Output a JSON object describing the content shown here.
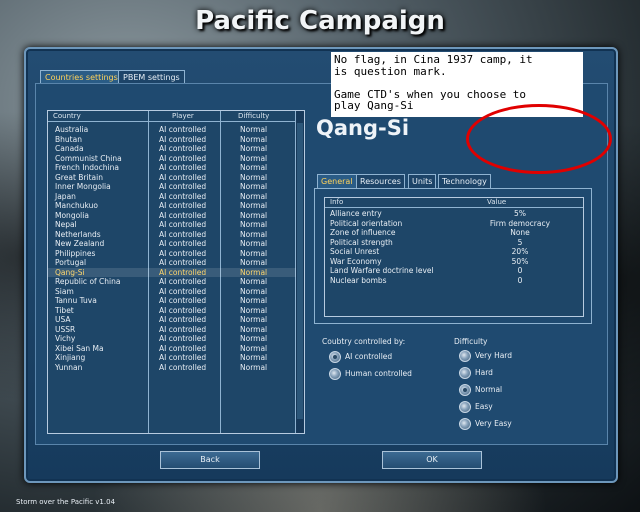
{
  "title": "Pacific Campaign",
  "tabs": [
    "Countries settings",
    "PBEM settings"
  ],
  "list": {
    "headers": [
      "Country",
      "Player",
      "Difficulty"
    ],
    "rows": [
      [
        "Australia",
        "AI controlled",
        "Normal"
      ],
      [
        "Bhutan",
        "AI controlled",
        "Normal"
      ],
      [
        "Canada",
        "AI controlled",
        "Normal"
      ],
      [
        "Communist China",
        "AI controlled",
        "Normal"
      ],
      [
        "French Indochina",
        "AI controlled",
        "Normal"
      ],
      [
        "Great Britain",
        "AI controlled",
        "Normal"
      ],
      [
        "Inner Mongolia",
        "AI controlled",
        "Normal"
      ],
      [
        "Japan",
        "AI controlled",
        "Normal"
      ],
      [
        "Manchukuo",
        "AI controlled",
        "Normal"
      ],
      [
        "Mongolia",
        "AI controlled",
        "Normal"
      ],
      [
        "Nepal",
        "AI controlled",
        "Normal"
      ],
      [
        "Netherlands",
        "AI controlled",
        "Normal"
      ],
      [
        "New Zealand",
        "AI controlled",
        "Normal"
      ],
      [
        "Philippines",
        "AI controlled",
        "Normal"
      ],
      [
        "Portugal",
        "AI controlled",
        "Normal"
      ],
      [
        "Qang-Si",
        "AI controlled",
        "Normal"
      ],
      [
        "Republic of China",
        "AI controlled",
        "Normal"
      ],
      [
        "Siam",
        "AI controlled",
        "Normal"
      ],
      [
        "Tannu Tuva",
        "AI controlled",
        "Normal"
      ],
      [
        "Tibet",
        "AI controlled",
        "Normal"
      ],
      [
        "USA",
        "AI controlled",
        "Normal"
      ],
      [
        "USSR",
        "AI controlled",
        "Normal"
      ],
      [
        "Vichy",
        "AI controlled",
        "Normal"
      ],
      [
        "Xibei San Ma",
        "AI controlled",
        "Normal"
      ],
      [
        "Xinjiang",
        "AI controlled",
        "Normal"
      ],
      [
        "Yunnan",
        "AI controlled",
        "Normal"
      ]
    ],
    "selected_index": 15
  },
  "country_name": "Qang-Si",
  "info_tabs": [
    "General",
    "Resources",
    "Units",
    "Technology"
  ],
  "info": {
    "headers": [
      "Info",
      "Value"
    ],
    "rows": [
      [
        "Alliance entry",
        "5%"
      ],
      [
        "Political orientation",
        "Firm democracy"
      ],
      [
        "Zone of influence",
        "None"
      ],
      [
        "Political strength",
        "5"
      ],
      [
        "Social Unrest",
        "20%"
      ],
      [
        "War Economy",
        "50%"
      ],
      [
        "Land Warfare doctrine level",
        "0"
      ],
      [
        "Nuclear bombs",
        "0"
      ]
    ]
  },
  "control": {
    "label": "Coubtry controlled by:",
    "options": [
      "AI controlled",
      "Human controlled"
    ],
    "selected": "AI controlled"
  },
  "difficulty": {
    "label": "Difficulty",
    "options": [
      "Very Hard",
      "Hard",
      "Normal",
      "Easy",
      "Very Easy"
    ],
    "selected": "Normal"
  },
  "buttons": {
    "back": "Back",
    "ok": "OK"
  },
  "version": "Storm over the Pacific v1.04",
  "annotation": {
    "text": "No flag, in Cina 1937 camp, it\nis question mark.\n\nGame CTD's when you choose to\nplay Qang-Si",
    "circle_color": "#e00000"
  }
}
